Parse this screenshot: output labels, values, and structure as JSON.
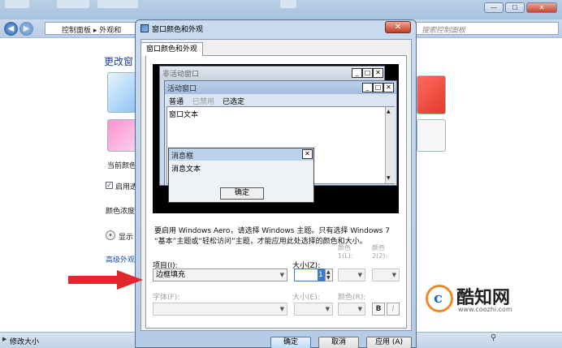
{
  "explorer": {
    "breadcrumb_1": "控制面板",
    "breadcrumb_2": "外观和",
    "search_placeholder": "搜索控制面板",
    "heading": "更改窗",
    "current_color_label": "当前颜色",
    "enable_transparency_label": "启用透",
    "color_intensity_label": "颜色浓度",
    "show_mixer_label": "显示",
    "advanced_link": "高级外观",
    "status_text": "修改大小",
    "win_min": "—",
    "win_max": "☐",
    "win_close": "✕"
  },
  "dialog": {
    "title": "窗口颜色和外观",
    "close_glyph": "✕",
    "tab_label": "窗口颜色和外观",
    "preview": {
      "inactive_title": "非活动窗口",
      "active_title": "活动窗口",
      "menu_normal": "普通",
      "menu_disabled": "已禁用",
      "menu_selected": "已选定",
      "window_text": "窗口文本",
      "msgbox_title": "消息框",
      "msgbox_text": "消息文本",
      "ok_label": "确定",
      "btn_min": "_",
      "btn_max": "□",
      "btn_close": "✕"
    },
    "info_text": "要启用 Windows Aero，请选择 Windows 主题。只有选择 Windows 7 “基本”主题或“轻松访问”主题，才能应用此处选择的颜色和大小。",
    "item_label": "项目(I):",
    "item_value": "边框填充",
    "size_label": "大小(Z):",
    "size_value": "1",
    "color1_label_a": "颜色",
    "color1_label_b": "1(L):",
    "color2_label_a": "颜色",
    "color2_label_b": "2(2):",
    "font_label": "字体(F):",
    "font_size_label": "大小(E):",
    "font_color_label": "颜色(R):",
    "bold_label": "B",
    "italic_label": "I",
    "ok_button": "确定",
    "cancel_button": "取消",
    "apply_button": "应用 (A)"
  },
  "watermark": {
    "name": "酷知网",
    "url": "www.coozhi.com"
  },
  "colors": {
    "arrow": "#e3262e",
    "logo_orange": "#f08a2b",
    "logo_blue": "#1f6bd0"
  }
}
